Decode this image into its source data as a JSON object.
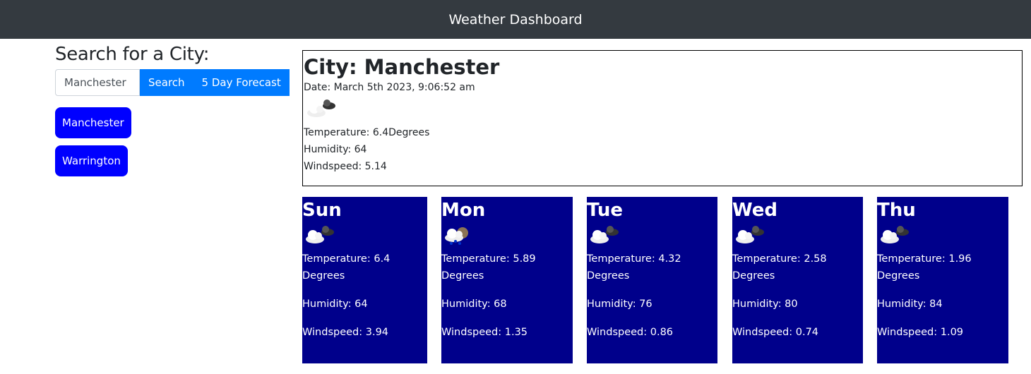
{
  "header": {
    "title": "Weather Dashboard"
  },
  "search": {
    "heading": "Search for a City:",
    "input_value": "Manchester",
    "search_label": "Search",
    "forecast_label": "5 Day Forecast"
  },
  "history": [
    "Manchester",
    "Warrington"
  ],
  "current": {
    "city": "City: Manchester",
    "date": "Date: March 5th 2023, 9:06:52 am",
    "icon": "cloudy-icon",
    "temperature": "Temperature: 6.4Degrees",
    "humidity": "Humidity: 64",
    "windspeed": "Windspeed: 5.14"
  },
  "forecast": [
    {
      "day": "Sun",
      "icon": "cloudy-icon",
      "temperature": "Temperature: 6.4",
      "unit": "Degrees",
      "humidity": "Humidity: 64",
      "windspeed": "Windspeed: 3.94"
    },
    {
      "day": "Mon",
      "icon": "rain-icon",
      "temperature": "Temperature: 5.89",
      "unit": "Degrees",
      "humidity": "Humidity: 68",
      "windspeed": "Windspeed: 1.35"
    },
    {
      "day": "Tue",
      "icon": "cloudy-icon",
      "temperature": "Temperature: 4.32",
      "unit": "Degrees",
      "humidity": "Humidity: 76",
      "windspeed": "Windspeed: 0.86"
    },
    {
      "day": "Wed",
      "icon": "cloudy-icon",
      "temperature": "Temperature: 2.58",
      "unit": "Degrees",
      "humidity": "Humidity: 80",
      "windspeed": "Windspeed: 0.74"
    },
    {
      "day": "Thu",
      "icon": "cloudy-icon",
      "temperature": "Temperature: 1.96",
      "unit": "Degrees",
      "humidity": "Humidity: 84",
      "windspeed": "Windspeed: 1.09"
    }
  ]
}
